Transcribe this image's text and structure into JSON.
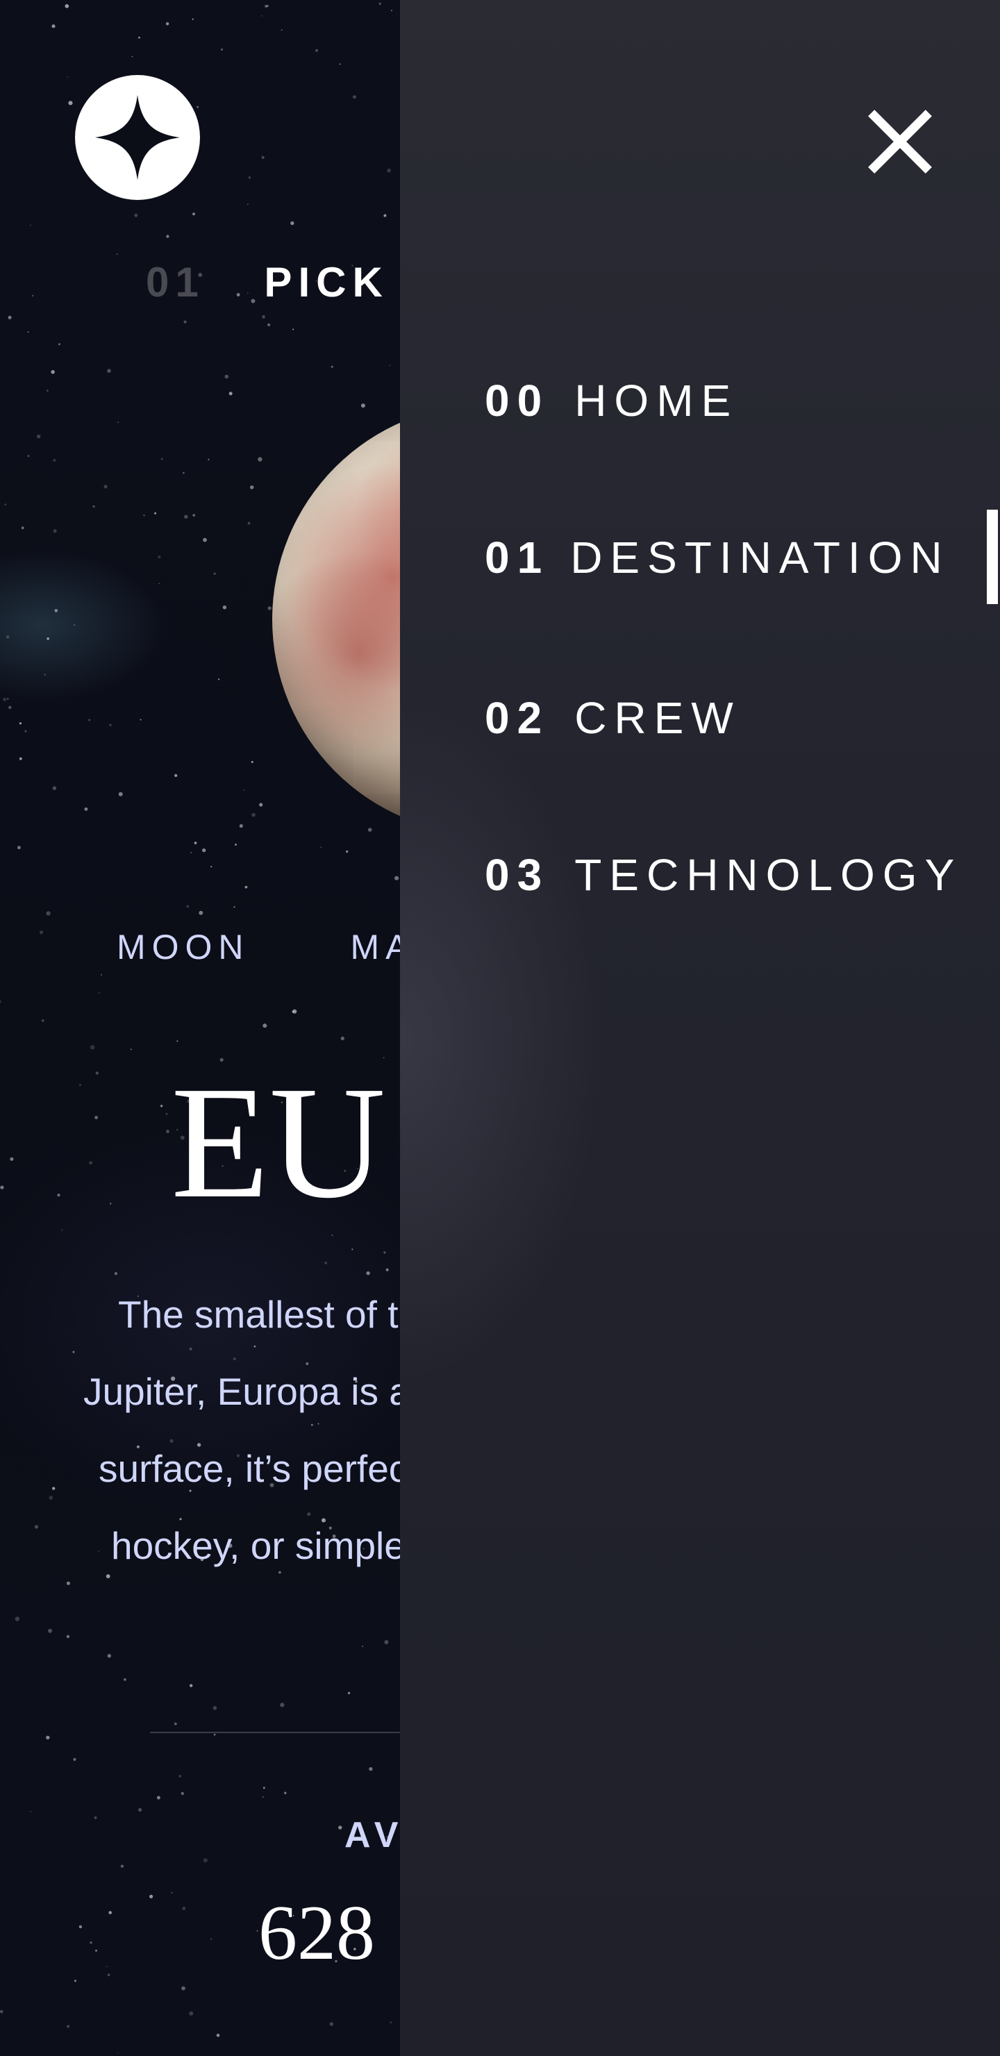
{
  "header": {
    "logo_icon": "four-point-star-icon",
    "close_icon": "close-icon"
  },
  "page": {
    "subheading_number": "01",
    "subheading_text": "PICK"
  },
  "destination_tabs": [
    "MOON",
    "MAR"
  ],
  "planet": {
    "name": "EU",
    "description_lines": [
      "The smallest of th",
      "Jupiter, Europa is a",
      "surface, it’s perfect",
      "hockey, or simple"
    ],
    "stat_label": "AV",
    "stat_value": "628"
  },
  "nav_menu": {
    "items": [
      {
        "number": "00",
        "label": "HOME"
      },
      {
        "number": "01",
        "label": "DESTINATION"
      },
      {
        "number": "02",
        "label": "CREW"
      },
      {
        "number": "03",
        "label": "TECHNOLOGY"
      }
    ],
    "active_item": "DESTINATION"
  },
  "colors": {
    "background": "#0b0d17",
    "panel": "#25262f",
    "accent_text": "#d0d6f9",
    "white": "#ffffff"
  }
}
